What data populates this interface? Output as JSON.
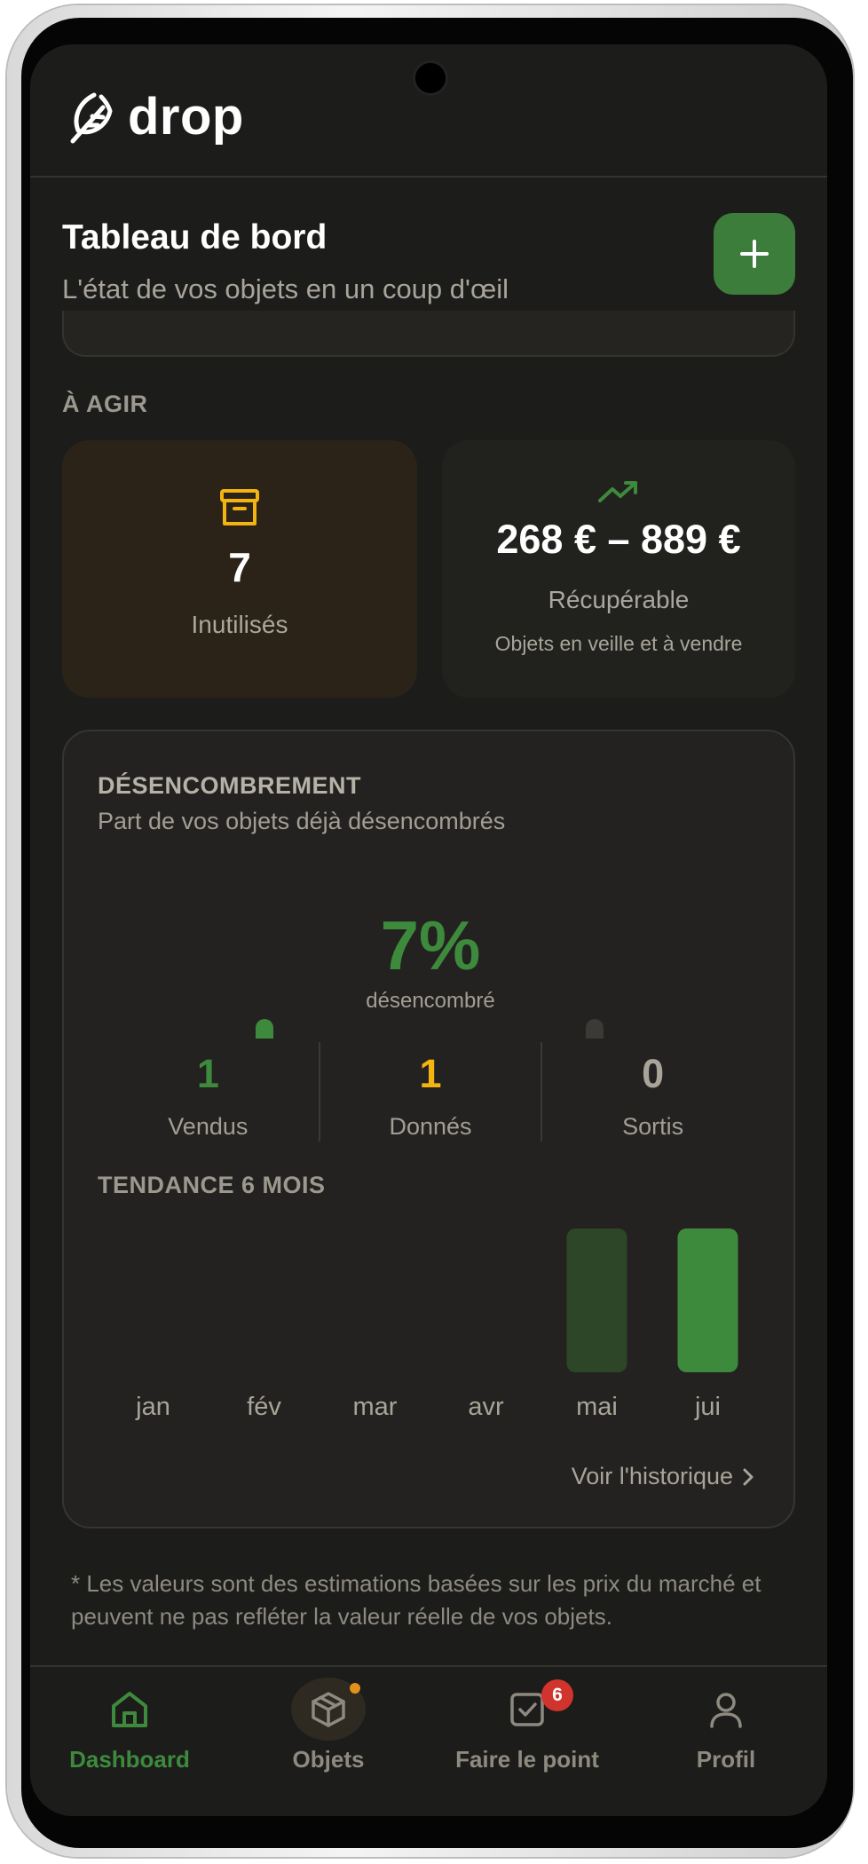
{
  "app": {
    "name": "drop"
  },
  "page": {
    "title": "Tableau de bord",
    "subtitle": "L'état de vos objets en un coup d'œil"
  },
  "toolbar": {
    "add_icon": "plus-icon"
  },
  "act_section": {
    "label": "À AGIR",
    "unused": {
      "icon": "archive-box-icon",
      "count": "7",
      "label": "Inutilisés",
      "accent": "#f2b40e"
    },
    "recoverable": {
      "icon": "trending-up-icon",
      "amount": "268 € – 889 €",
      "label": "Récupérable",
      "note": "Objets en veille et à vendre",
      "accent": "#3e8a3d"
    }
  },
  "declutter": {
    "title": "DÉSENCOMBREMENT",
    "subtitle": "Part de vos objets déjà désencombrés",
    "percent": "7%",
    "percent_label": "désencombré",
    "stats": [
      {
        "value": "1",
        "label": "Vendus",
        "color": "#3e8a3d"
      },
      {
        "value": "1",
        "label": "Donnés",
        "color": "#f2b40e"
      },
      {
        "value": "0",
        "label": "Sortis",
        "color": "#a8a49a"
      }
    ],
    "trend_title": "TENDANCE 6 MOIS",
    "history_link": "Voir l'historique"
  },
  "chart_data": {
    "type": "bar",
    "categories": [
      "jan",
      "fév",
      "mar",
      "avr",
      "mai",
      "jui"
    ],
    "values": [
      0,
      0,
      0,
      0,
      1,
      1
    ],
    "colors": [
      "#3e8a3d",
      "#3e8a3d",
      "#3e8a3d",
      "#3e8a3d",
      "#2d4627",
      "#3e8a3d"
    ]
  },
  "disclaimer": "* Les valeurs sont des estimations basées sur les prix du marché et peuvent ne pas refléter la valeur réelle de vos objets.",
  "nav": {
    "items": [
      {
        "label": "Dashboard",
        "icon": "home-icon",
        "active": true
      },
      {
        "label": "Objets",
        "icon": "package-icon",
        "has_dot": true
      },
      {
        "label": "Faire le point",
        "icon": "checkbox-icon",
        "badge": "6"
      },
      {
        "label": "Profil",
        "icon": "user-icon"
      }
    ],
    "active_color": "#3e8a3d",
    "inactive_color": "#8e8a80"
  }
}
